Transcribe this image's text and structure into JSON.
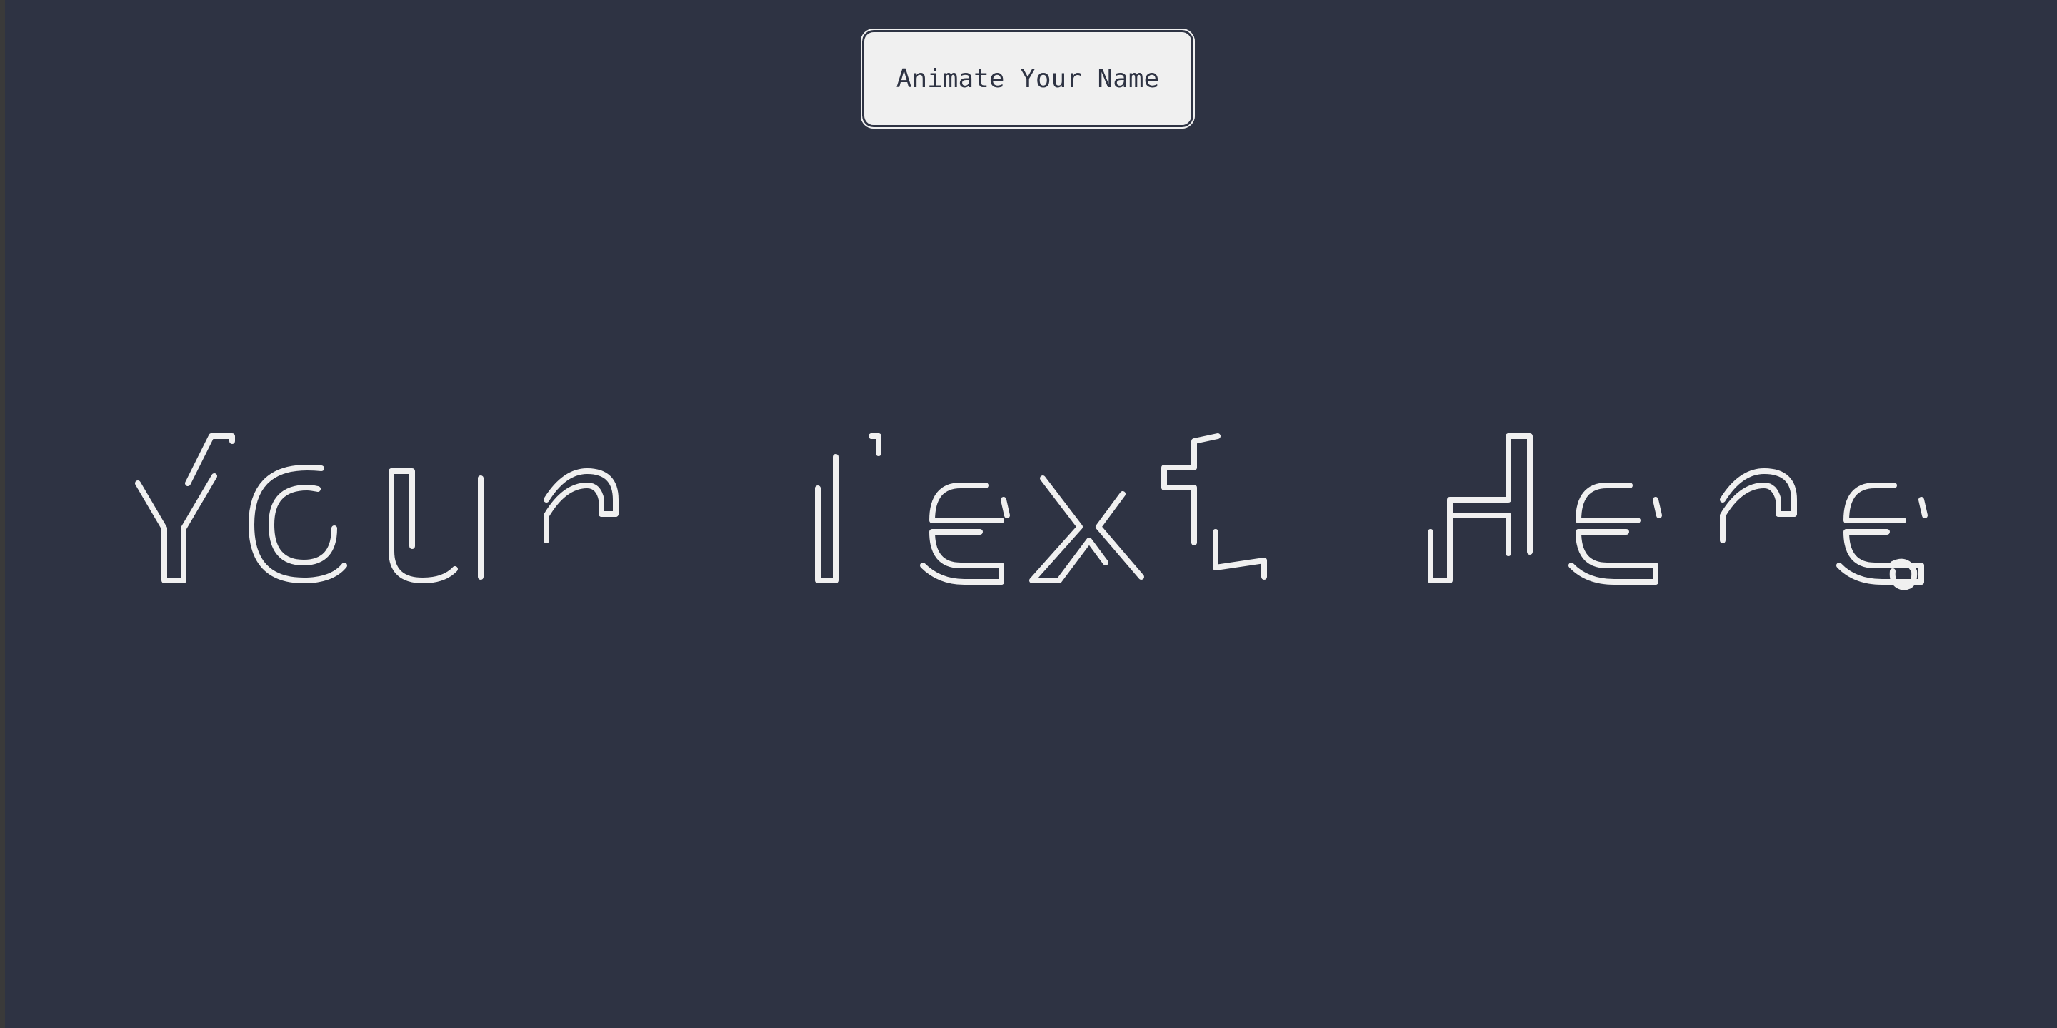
{
  "controls": {
    "animate_button_label": "Animate Your Name"
  },
  "display": {
    "text": "Your Text Here"
  },
  "colors": {
    "background": "#2e3343",
    "foreground": "#f0f0f0",
    "frame": "#3a3a3a"
  }
}
